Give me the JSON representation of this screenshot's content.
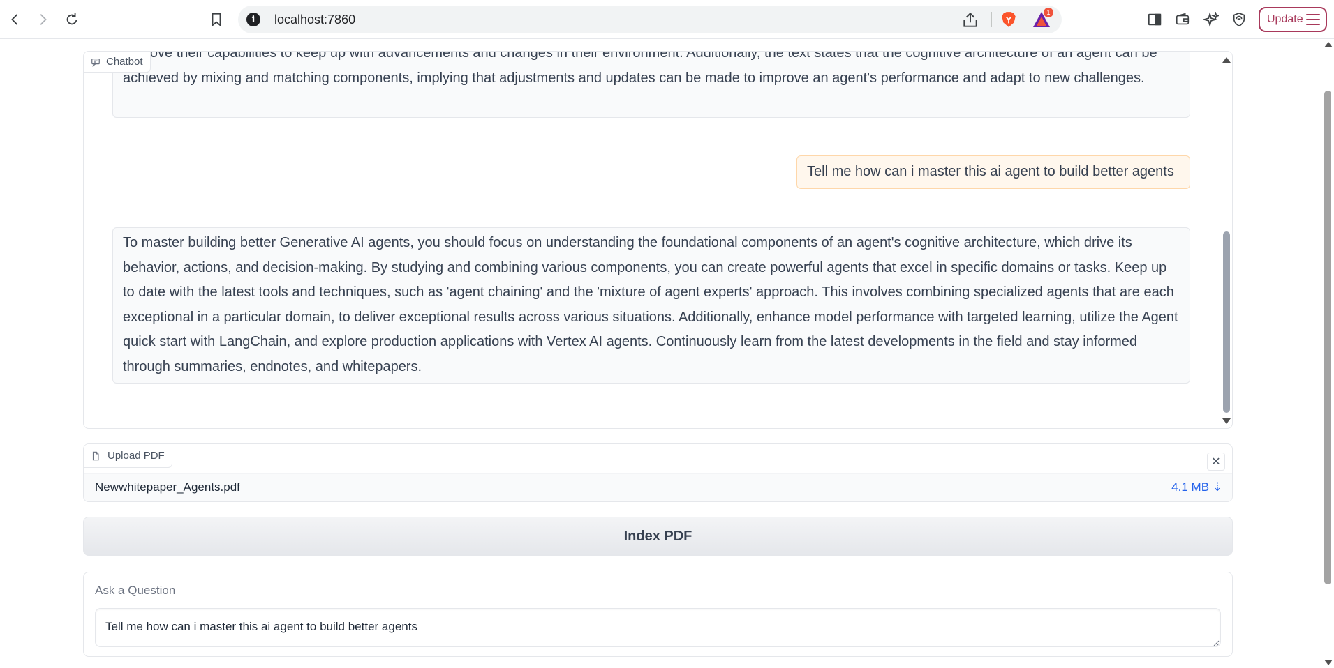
{
  "browser": {
    "url": "localhost:7860",
    "update_label": "Update",
    "rewards_badge": "1"
  },
  "chatbot": {
    "label": "Chatbot",
    "messages": [
      {
        "role": "bot",
        "text": "improve their capabilities to keep up with advancements and changes in their environment. Additionally, the text states that the cognitive architecture of an agent can be achieved by mixing and matching components, implying that adjustments and updates can be made to improve an agent's performance and adapt to new challenges."
      },
      {
        "role": "user",
        "text": "Tell me how can i master this ai agent to build better agents"
      },
      {
        "role": "bot",
        "text": "To master building better Generative AI agents, you should focus on understanding the foundational components of an agent's cognitive architecture, which drive its behavior, actions, and decision-making. By studying and combining various components, you can create powerful agents that excel in specific domains or tasks. Keep up to date with the latest tools and techniques, such as 'agent chaining' and the 'mixture of agent experts' approach. This involves combining specialized agents that are each exceptional in a particular domain, to deliver exceptional results across various situations. Additionally, enhance model performance with targeted learning, utilize the Agent quick start with LangChain, and explore production applications with Vertex AI agents. Continuously learn from the latest developments in the field and stay informed through summaries, endnotes, and whitepapers."
      }
    ]
  },
  "upload": {
    "label": "Upload PDF",
    "file_name": "Newwhitepaper_Agents.pdf",
    "file_size": "4.1 MB ⇣",
    "clear_symbol": "✕"
  },
  "index_button": {
    "label": "Index PDF"
  },
  "question": {
    "label": "Ask a Question",
    "value": "Tell me how can i master this ai agent to build better agents"
  },
  "colors": {
    "accent_update": "#a8395b",
    "brave_orange": "#fb542b",
    "user_bubble": "#fff7ed",
    "bot_bubble": "#f9fafb",
    "file_size_blue": "#2563eb"
  }
}
